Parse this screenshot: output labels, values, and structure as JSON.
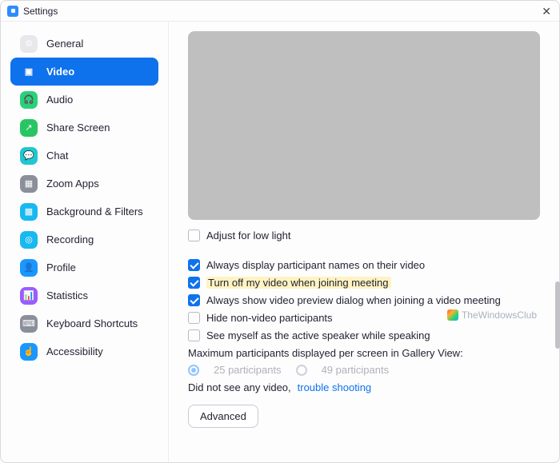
{
  "title": "Settings",
  "sidebar": [
    {
      "label": "General",
      "icon_bg": "#e7e7ec"
    },
    {
      "label": "Video",
      "icon_bg": "#0e72ed",
      "active": true
    },
    {
      "label": "Audio",
      "icon_bg": "#27d27a"
    },
    {
      "label": "Share Screen",
      "icon_bg": "#27c662"
    },
    {
      "label": "Chat",
      "icon_bg": "#1fc7d0"
    },
    {
      "label": "Zoom Apps",
      "icon_bg": "#8a8f9a"
    },
    {
      "label": "Background & Filters",
      "icon_bg": "#17b9f0"
    },
    {
      "label": "Recording",
      "icon_bg": "#17b9f0"
    },
    {
      "label": "Profile",
      "icon_bg": "#1a97ff"
    },
    {
      "label": "Statistics",
      "icon_bg": "#9a5cff"
    },
    {
      "label": "Keyboard Shortcuts",
      "icon_bg": "#8a8f9a"
    },
    {
      "label": "Accessibility",
      "icon_bg": "#1a97ff"
    }
  ],
  "video": {
    "adjust_low_light": {
      "label": "Adjust for low light",
      "checked": false
    },
    "opts": [
      {
        "label": "Always display participant names on their video",
        "checked": true,
        "highlight": false
      },
      {
        "label": "Turn off my video when joining meeting",
        "checked": true,
        "highlight": true
      },
      {
        "label": "Always show video preview dialog when joining a video meeting",
        "checked": true,
        "highlight": false
      },
      {
        "label": "Hide non-video participants",
        "checked": false,
        "highlight": false
      },
      {
        "label": "See myself as the active speaker while speaking",
        "checked": false,
        "highlight": false
      }
    ],
    "max_label": "Maximum participants displayed per screen in Gallery View:",
    "radios": [
      {
        "label": "25 participants",
        "selected": true
      },
      {
        "label": "49 participants",
        "selected": false
      }
    ],
    "no_video_text": "Did not see any video,",
    "trouble_link": "trouble shooting",
    "advanced_btn": "Advanced"
  },
  "watermark": "TheWindowsClub"
}
